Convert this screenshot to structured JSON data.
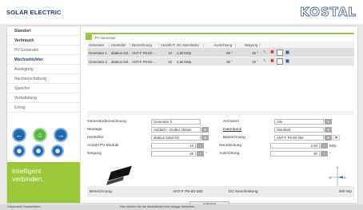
{
  "app_title": "SOLAR ELECTRIC",
  "brand": "KOSTAL",
  "sidebar": {
    "items": [
      {
        "label": "Standort"
      },
      {
        "label": "Verbrauch"
      },
      {
        "label": "PV Generator"
      },
      {
        "label": "Wechselrichter"
      },
      {
        "label": "Auslegung"
      },
      {
        "label": "Nachverschaltung"
      },
      {
        "label": "Speicher"
      },
      {
        "label": "Verkabelung"
      },
      {
        "label": "Ertrag"
      }
    ],
    "active_index": 3,
    "nav_buttons": {
      "back": "back-arrow-icon",
      "home": "home-icon",
      "forward": "forward-arrow-icon"
    },
    "promo_line1": "Intelligent",
    "promo_line2": "verbinden."
  },
  "section_title": "PV Generator",
  "table": {
    "headers": [
      "Generator",
      "Hersteller",
      "Bezeichnung",
      "Anzahl PV M",
      "DC-Nennleistu",
      "Ausrichtung",
      "Neigung"
    ],
    "rows": [
      [
        "Generator 1",
        "abakus Sol...",
        "ANT-F P6-60-...",
        "10",
        "2,50 kWp",
        "-90 °",
        "45 °"
      ],
      [
        "Generator 2",
        "abakus Sol...",
        "ANT-F P6-60-...",
        "10",
        "2,50 kWp",
        "90 °",
        "45 °"
      ]
    ]
  },
  "form": {
    "generator_label": "Generatorbezeichnung",
    "generator_value": "Generator 3",
    "archiv_label": "Archiviert",
    "archiv_value": "Alle",
    "montage_label": "Montage",
    "montage_value": "Aufdach - Großer Abstan",
    "datenbank_label": "Datenbank",
    "datenbank_value": "Standard",
    "hersteller_label": "Hersteller",
    "hersteller_value": "abakus Solar AG",
    "bezeichnung_label": "Bezeichnung",
    "bezeichnung_value": "ANT-F P6-60-250",
    "anzahl_label": "Anzahl PV Module",
    "anzahl_value": "10",
    "nennleistung_label": "Nennleistung",
    "nennleistung_value": "2,50",
    "nennleistung_unit": "kWp",
    "neigung_label": "Neigung",
    "neigung_value": "45",
    "ausrichtung_label": "Ausrichtung",
    "ausrichtung_value": "90",
    "degree_unit": "°"
  },
  "compass": {
    "n": "N",
    "s": "S",
    "w": "W",
    "o": "O"
  },
  "anlegen_label": "Anlegen",
  "summary": {
    "label1": "Bezeichnung",
    "value1": "ANT-F P6-60-250",
    "label2": "DC-Nennleistung",
    "value2": "250 Wp"
  },
  "footer": {
    "location": "Düsseldorf, Deutschland",
    "hint": "Hier können Sie die Modulfelder Ihrer Anlage definieren."
  },
  "colors": {
    "accent": "#9bc837",
    "brand_blue": "#1d3e6e",
    "nav_blue": "#1c68b3",
    "home_green": "#58b83f"
  }
}
